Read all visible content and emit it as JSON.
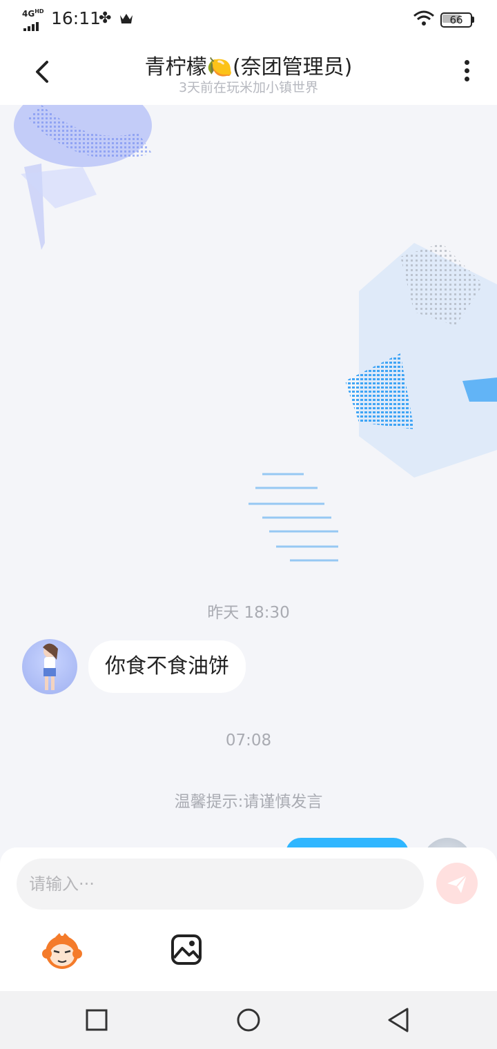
{
  "status_bar": {
    "network": "4G",
    "network_badge": "HD",
    "time": "16:11",
    "battery": "66"
  },
  "header": {
    "title": "青柠檬🍋(奈团管理员)",
    "subtitle": "3天前在玩米加小镇世界"
  },
  "messages": {
    "timestamp1": "昨天 18:30",
    "received_text": "你食不食油饼",
    "timestamp2": "07:08",
    "tip": "温馨提示:请谨慎发言"
  },
  "input": {
    "placeholder": "请输入···"
  },
  "colors": {
    "accent_blue": "#2fb6ff",
    "send_button": "#ffe0df",
    "background": "#f4f5f9"
  },
  "icons": {
    "back": "chevron-left-icon",
    "more": "more-vertical-icon",
    "send": "paper-plane-icon",
    "emoji": "mascot-emoji-icon",
    "image": "image-icon",
    "nav_recent": "square-icon",
    "nav_home": "circle-icon",
    "nav_back": "triangle-back-icon"
  }
}
